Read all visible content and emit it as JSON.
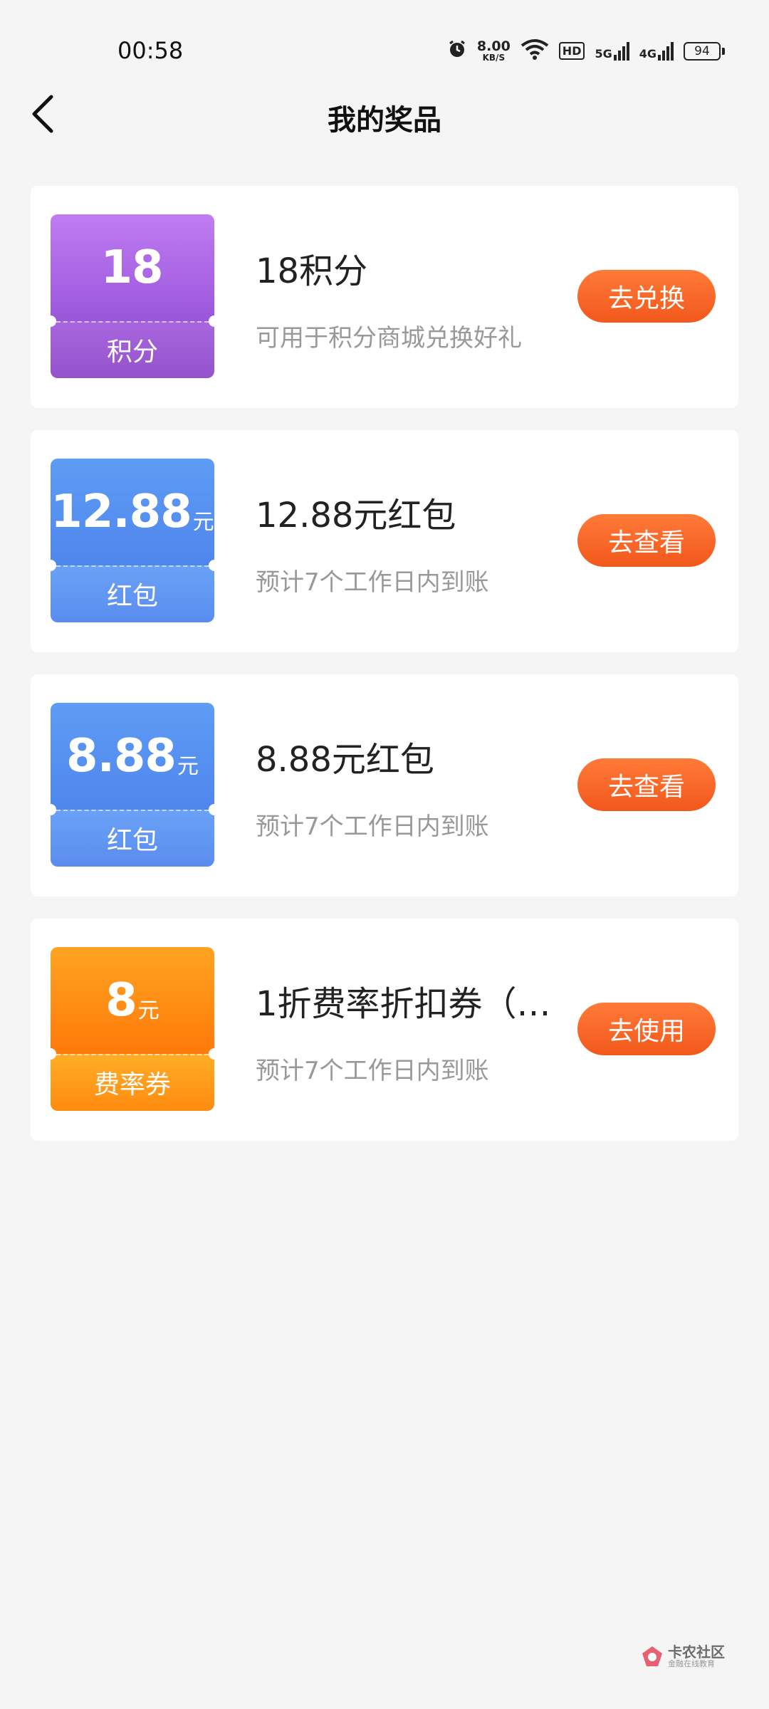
{
  "status_bar": {
    "time": "00:58",
    "net_speed": "8.00",
    "net_unit": "KB/S",
    "hd": "HD",
    "sig1": "5G",
    "sig2": "4G",
    "battery": "94"
  },
  "header": {
    "title": "我的奖品"
  },
  "prizes": [
    {
      "badge_value": "18",
      "badge_unit": "",
      "badge_label": "积分",
      "name": "18积分",
      "desc": "可用于积分商城兑换好礼",
      "action": "去兑换",
      "color": "#9a56da"
    },
    {
      "badge_value": "12.88",
      "badge_unit": "元",
      "badge_label": "红包",
      "name": "12.88元红包",
      "desc": "预计7个工作日内到账",
      "action": "去查看",
      "color": "#4f86ec"
    },
    {
      "badge_value": "8.88",
      "badge_unit": "元",
      "badge_label": "红包",
      "name": "8.88元红包",
      "desc": "预计7个工作日内到账",
      "action": "去查看",
      "color": "#4f86ec"
    },
    {
      "badge_value": "8",
      "badge_unit": "元",
      "badge_label": "费率券",
      "name": "1折费率折扣券（…",
      "desc": "预计7个工作日内到账",
      "action": "去使用",
      "color": "#ff7a0a"
    }
  ],
  "watermark": {
    "main": "卡农社区",
    "sub": "金融在线教育"
  },
  "accent_color": "#f2581c"
}
